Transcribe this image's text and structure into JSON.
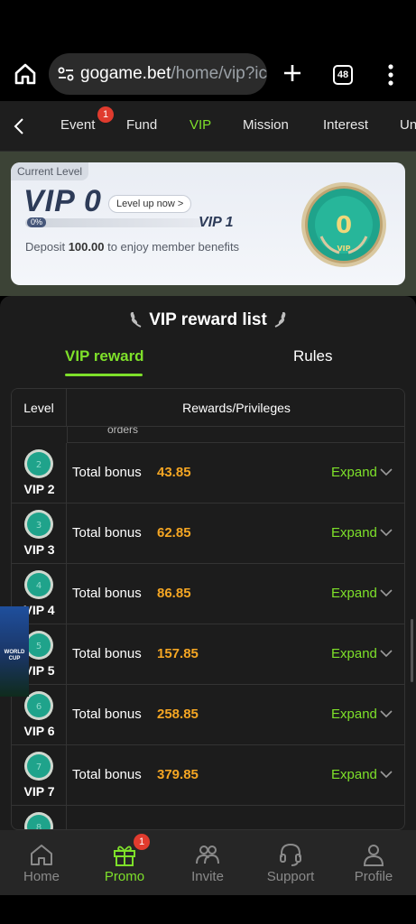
{
  "browser": {
    "url_host": "gogame.bet",
    "url_path": "/home/vip?ic",
    "tab_count": "48"
  },
  "topnav": {
    "tabs": [
      {
        "label": "Event",
        "badge": "1"
      },
      {
        "label": "Fund"
      },
      {
        "label": "VIP",
        "active": true
      },
      {
        "label": "Mission"
      },
      {
        "label": "Interest"
      },
      {
        "label": "Un"
      }
    ]
  },
  "vip_card": {
    "current_level_label": "Current Level",
    "level": "VIP 0",
    "level_up_label": "Level up now >",
    "progress_percent": 0,
    "progress_label": "0%",
    "next_level": "VIP 1",
    "deposit_prefix": "Deposit",
    "deposit_amount": "100.00",
    "deposit_suffix": "to enjoy member benefits",
    "medal_number": "0",
    "medal_caption": "VIP"
  },
  "reward_list": {
    "title": "VIP reward list",
    "tabs": {
      "reward": "VIP reward",
      "rules": "Rules"
    },
    "columns": {
      "level": "Level",
      "rewards": "Rewards/Privileges"
    },
    "partial_text": "orders",
    "rows": [
      {
        "level": "VIP 2",
        "coin": "2",
        "label": "Total bonus",
        "amount": "43.85",
        "expand": "Expand"
      },
      {
        "level": "VIP 3",
        "coin": "3",
        "label": "Total bonus",
        "amount": "62.85",
        "expand": "Expand"
      },
      {
        "level": "VIP 4",
        "coin": "4",
        "label": "Total bonus",
        "amount": "86.85",
        "expand": "Expand"
      },
      {
        "level": "VIP 5",
        "coin": "5",
        "label": "Total bonus",
        "amount": "157.85",
        "expand": "Expand"
      },
      {
        "level": "VIP 6",
        "coin": "6",
        "label": "Total bonus",
        "amount": "258.85",
        "expand": "Expand"
      },
      {
        "level": "VIP 7",
        "coin": "7",
        "label": "Total bonus",
        "amount": "379.85",
        "expand": "Expand"
      },
      {
        "level": "",
        "coin": "8",
        "label": "",
        "amount": "",
        "expand": ""
      }
    ]
  },
  "ad": {
    "text": "WORLD CUP"
  },
  "bottomnav": {
    "items": [
      {
        "label": "Home",
        "icon": "home-icon"
      },
      {
        "label": "Promo",
        "icon": "gift-icon",
        "badge": "1",
        "active": true
      },
      {
        "label": "Invite",
        "icon": "people-icon"
      },
      {
        "label": "Support",
        "icon": "headset-icon"
      },
      {
        "label": "Profile",
        "icon": "person-icon"
      }
    ]
  },
  "colors": {
    "accent": "#7ee02a",
    "amount": "#f5a623",
    "badge": "#e03b2e",
    "medal": "#1fa38b"
  }
}
